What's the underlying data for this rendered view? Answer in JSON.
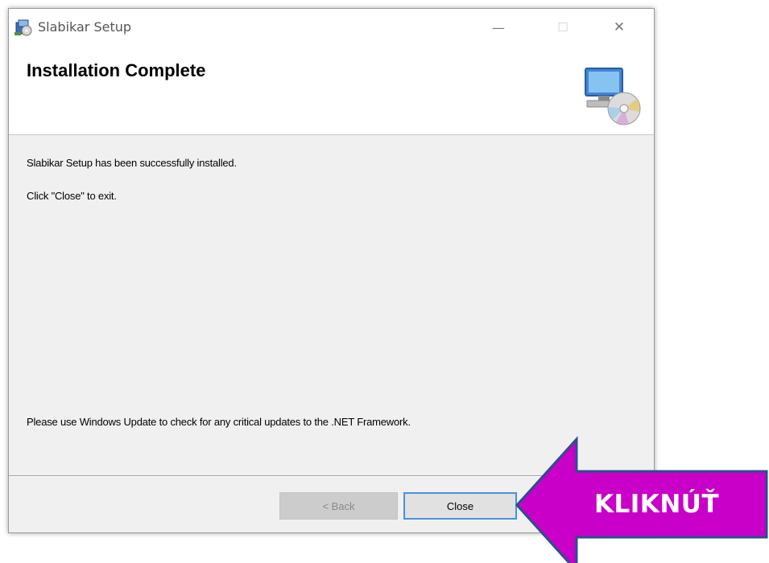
{
  "window": {
    "title": "Slabikar Setup",
    "icon": "setup-package-icon",
    "controls": {
      "minimize": "—",
      "maximize": "☐",
      "close": "✕"
    }
  },
  "header": {
    "title": "Installation Complete",
    "icon": "computer-cd-icon"
  },
  "content": {
    "message": "Slabikar Setup has been successfully installed.",
    "instruction": "Click \"Close\" to exit.",
    "notice": "Please use Windows Update to check for any critical updates to the .NET Framework."
  },
  "buttons": {
    "back": "< Back",
    "close": "Close"
  },
  "annotation": {
    "label": "KLIKNÚŤ",
    "color": "#c800c8",
    "icon": "left-arrow-callout"
  },
  "colors": {
    "focus_border": "#4a90e2",
    "dialog_background": "#f0f0f0"
  }
}
